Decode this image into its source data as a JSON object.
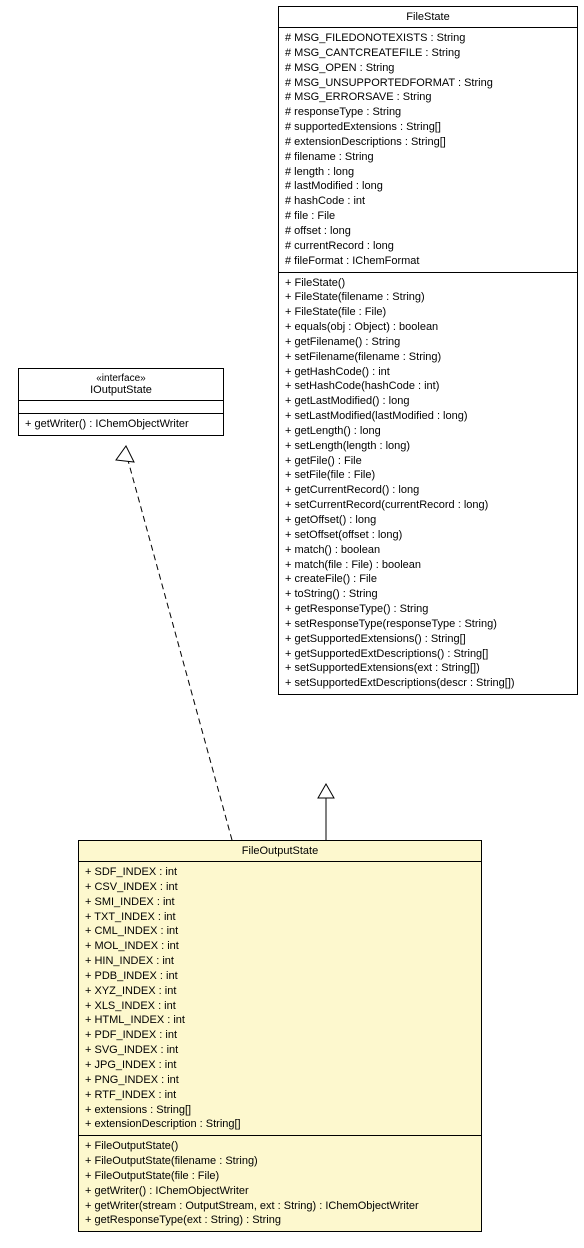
{
  "interface": {
    "stereotype": "«interface»",
    "name": "IOutputState",
    "methods": [
      "+ getWriter() : IChemObjectWriter"
    ]
  },
  "fileState": {
    "name": "FileState",
    "attributes": [
      "# MSG_FILEDONOTEXISTS : String",
      "# MSG_CANTCREATEFILE : String",
      "# MSG_OPEN : String",
      "# MSG_UNSUPPORTEDFORMAT : String",
      "# MSG_ERRORSAVE : String",
      "# responseType : String",
      "# supportedExtensions : String[]",
      "# extensionDescriptions : String[]",
      "# filename : String",
      "# length : long",
      "# lastModified : long",
      "# hashCode : int",
      "# file : File",
      "# offset : long",
      "# currentRecord : long",
      "# fileFormat : IChemFormat"
    ],
    "methods": [
      "+ FileState()",
      "+ FileState(filename : String)",
      "+ FileState(file : File)",
      "+ equals(obj : Object) : boolean",
      "+ getFilename() : String",
      "+ setFilename(filename : String)",
      "+ getHashCode() : int",
      "+ setHashCode(hashCode : int)",
      "+ getLastModified() : long",
      "+ setLastModified(lastModified : long)",
      "+ getLength() : long",
      "+ setLength(length : long)",
      "+ getFile() : File",
      "+ setFile(file : File)",
      "+ getCurrentRecord() : long",
      "+ setCurrentRecord(currentRecord : long)",
      "+ getOffset() : long",
      "+ setOffset(offset : long)",
      "+ match() : boolean",
      "+ match(file : File) : boolean",
      "+ createFile() : File",
      "+ toString() : String",
      "+ getResponseType() : String",
      "+ setResponseType(responseType : String)",
      "+ getSupportedExtensions() : String[]",
      "+ getSupportedExtDescriptions() : String[]",
      "+ setSupportedExtensions(ext : String[])",
      "+ setSupportedExtDescriptions(descr : String[])"
    ]
  },
  "fileOutputState": {
    "name": "FileOutputState",
    "attributes": [
      "+ SDF_INDEX : int",
      "+ CSV_INDEX : int",
      "+ SMI_INDEX : int",
      "+ TXT_INDEX : int",
      "+ CML_INDEX : int",
      "+ MOL_INDEX : int",
      "+ HIN_INDEX : int",
      "+ PDB_INDEX : int",
      "+ XYZ_INDEX : int",
      "+ XLS_INDEX : int",
      "+ HTML_INDEX : int",
      "+ PDF_INDEX : int",
      "+ SVG_INDEX : int",
      "+ JPG_INDEX : int",
      "+ PNG_INDEX : int",
      "+ RTF_INDEX : int",
      "+ extensions : String[]",
      "+ extensionDescription : String[]"
    ],
    "methods": [
      "+ FileOutputState()",
      "+ FileOutputState(filename : String)",
      "+ FileOutputState(file : File)",
      "+ getWriter() : IChemObjectWriter",
      "+ getWriter(stream : OutputStream, ext : String) : IChemObjectWriter",
      "+ getResponseType(ext : String) : String"
    ]
  }
}
